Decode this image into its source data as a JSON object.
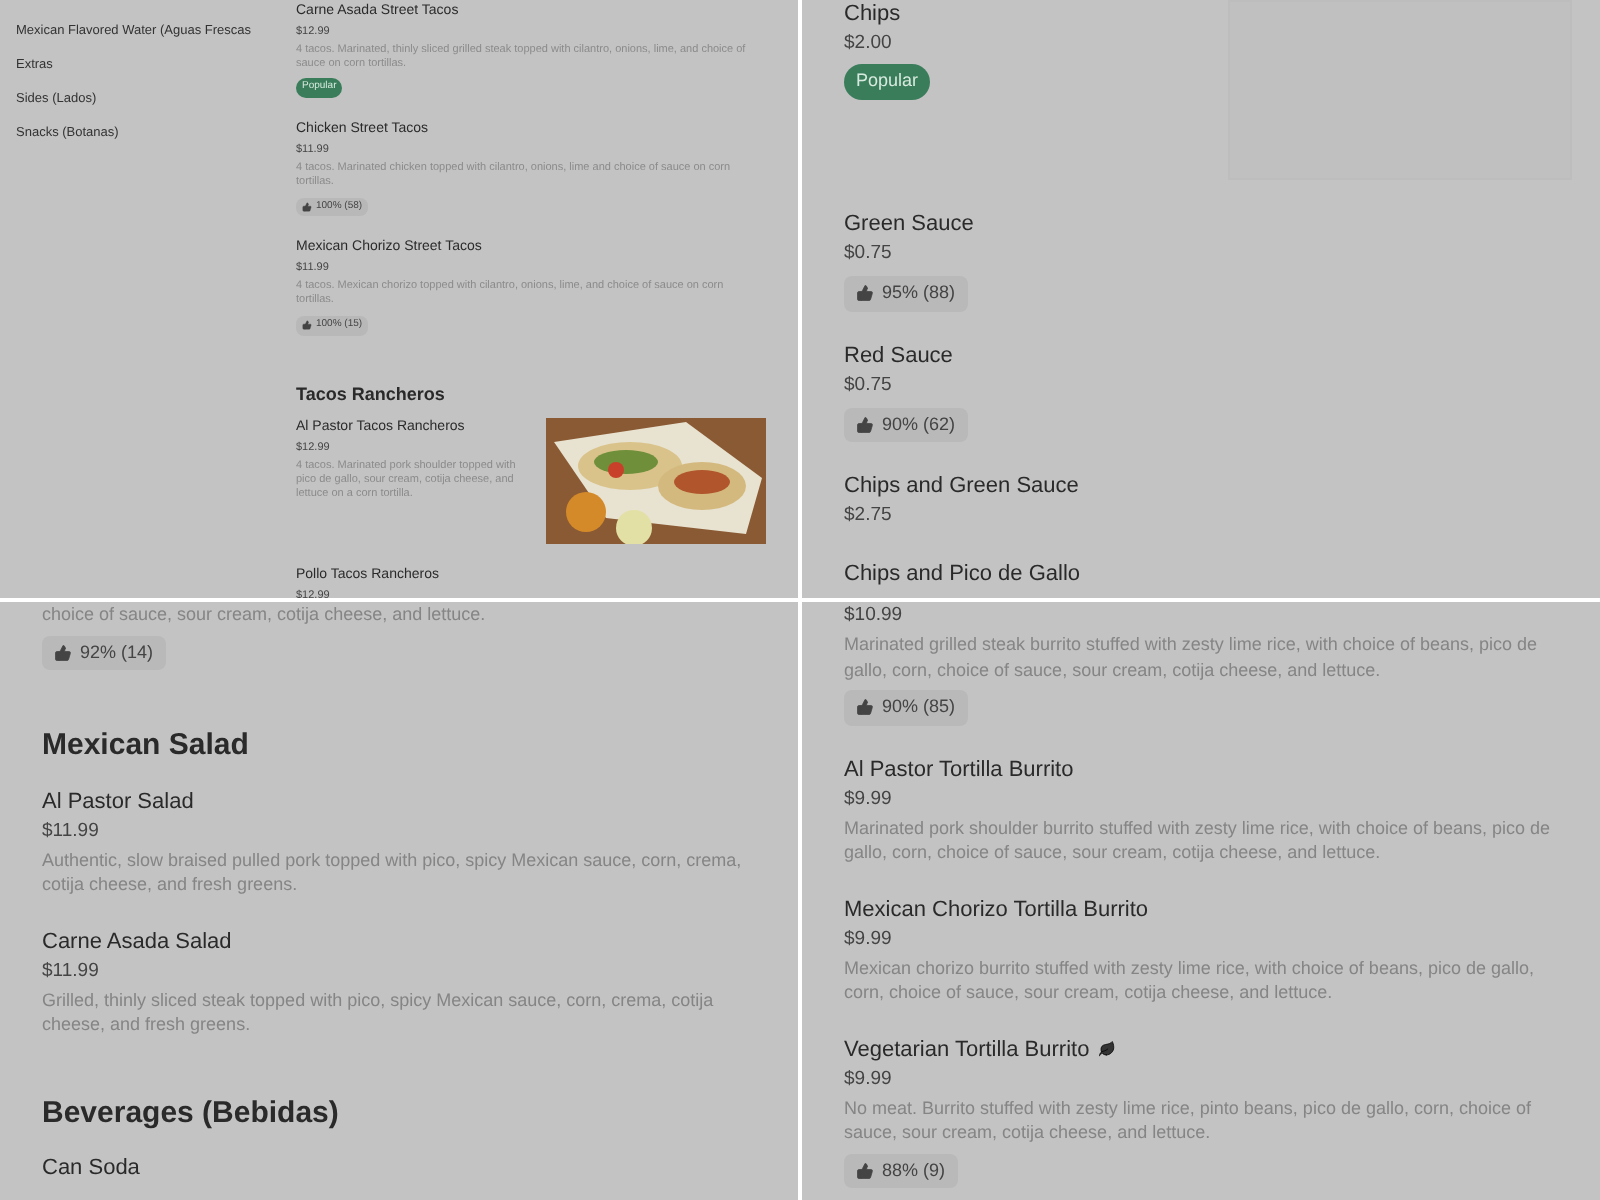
{
  "panels": [
    {
      "kind": "compact",
      "sidebar": {
        "items": [
          "Mexican Flavored Water (Aguas Frescas",
          "Extras",
          "Sides (Lados)",
          "Snacks (Botanas)"
        ]
      },
      "blocks": [
        {
          "kind": "item",
          "name": "Carne Asada Street Tacos",
          "price": "$12.99",
          "description": "4 tacos. Marinated, thinly sliced grilled steak topped with cilantro, onions, lime, and choice of sauce on corn tortillas.",
          "badge": "Popular"
        },
        {
          "kind": "item",
          "name": "Chicken Street Tacos",
          "price": "$11.99",
          "description": "4 tacos. Marinated chicken topped with cilantro, onions, lime and choice of sauce on corn tortillas.",
          "rating": "100% (58)"
        },
        {
          "kind": "item",
          "name": "Mexican Chorizo Street Tacos",
          "price": "$11.99",
          "description": "4 tacos. Mexican chorizo topped with cilantro, onions, lime, and choice of sauce on corn tortillas.",
          "rating": "100% (15)"
        },
        {
          "kind": "heading",
          "text": "Tacos Rancheros"
        },
        {
          "kind": "item",
          "name": "Al Pastor Tacos Rancheros",
          "price": "$12.99",
          "description": "4 tacos. Marinated pork shoulder topped with pico de gallo, sour cream, cotija cheese, and lettuce on a corn tortilla."
        },
        {
          "kind": "item",
          "name": "Pollo Tacos Rancheros",
          "price": "$12.99"
        }
      ]
    },
    {
      "kind": "regular",
      "blocks": [
        {
          "kind": "item",
          "name": "Chips",
          "price": "$2.00",
          "badge": "Popular",
          "image": {
            "kind": "placeholder"
          }
        },
        {
          "kind": "item",
          "name": "Green Sauce",
          "price": "$0.75",
          "rating": "95% (88)"
        },
        {
          "kind": "item",
          "name": "Red Sauce",
          "price": "$0.75",
          "rating": "90% (62)"
        },
        {
          "kind": "item",
          "name": "Chips and Green Sauce",
          "price": "$2.75"
        },
        {
          "kind": "item",
          "name": "Chips and Pico de Gallo"
        }
      ]
    },
    {
      "kind": "regular",
      "blocks": [
        {
          "kind": "item",
          "description": "choice of sauce, sour cream, cotija cheese, and lettuce.",
          "rating": "92% (14)"
        },
        {
          "kind": "heading",
          "text": "Mexican Salad"
        },
        {
          "kind": "item",
          "name": "Al Pastor Salad",
          "price": "$11.99",
          "description": "Authentic, slow braised pulled pork topped with pico, spicy Mexican sauce, corn, crema, cotija cheese, and fresh greens."
        },
        {
          "kind": "item",
          "name": "Carne Asada Salad",
          "price": "$11.99",
          "description": "Grilled, thinly sliced steak topped with pico, spicy Mexican sauce, corn, crema, cotija cheese, and fresh greens."
        },
        {
          "kind": "heading",
          "text": "Beverages (Bebidas)"
        },
        {
          "kind": "item",
          "name": "Can Soda"
        }
      ]
    },
    {
      "kind": "regular",
      "blocks": [
        {
          "kind": "item",
          "price": "$10.99",
          "description": "Marinated grilled steak burrito stuffed with zesty lime rice, with choice of beans, pico de gallo, corn, choice of sauce, sour cream, cotija cheese, and lettuce.",
          "rating": "90% (85)"
        },
        {
          "kind": "item",
          "name": "Al Pastor Tortilla Burrito",
          "price": "$9.99",
          "description": "Marinated pork shoulder burrito stuffed with zesty lime rice, with choice of beans, pico de gallo, corn, choice of sauce, sour cream, cotija cheese, and lettuce."
        },
        {
          "kind": "item",
          "name": "Mexican Chorizo Tortilla Burrito",
          "price": "$9.99",
          "description": "Mexican chorizo burrito stuffed with zesty lime rice, with choice of beans, pico de gallo, corn, choice of sauce, sour cream, cotija cheese, and lettuce."
        },
        {
          "kind": "item",
          "name": "Vegetarian Tortilla Burrito",
          "vegetarian": true,
          "price": "$9.99",
          "description": "No meat. Burrito stuffed with zesty lime rice, pinto beans, pico de gallo, corn, choice of sauce, sour cream, cotija cheese, and lettuce.",
          "rating": "88% (9)"
        }
      ]
    }
  ]
}
